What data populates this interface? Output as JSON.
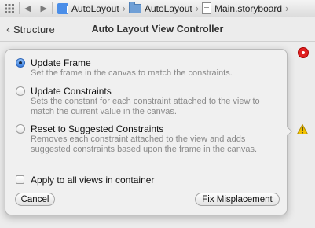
{
  "jumpbar": {
    "icons": [
      "grid-icon",
      "back-arrow-icon",
      "forward-arrow-icon"
    ],
    "path": [
      {
        "icon": "project-icon",
        "label": "AutoLayout"
      },
      {
        "icon": "folder-icon",
        "label": "AutoLayout"
      },
      {
        "icon": "storyboard-file-icon",
        "label": "Main.storyboard"
      }
    ]
  },
  "header": {
    "back_label": "Structure",
    "title": "Auto Layout View Controller"
  },
  "popover": {
    "options": [
      {
        "label": "Update Frame",
        "description": "Set the frame in the canvas to match the constraints.",
        "selected": true
      },
      {
        "label": "Update Constraints",
        "description": "Sets the constant for each constraint attached to the view to match the current value in the canvas.",
        "selected": false
      },
      {
        "label": "Reset to Suggested Constraints",
        "description": "Removes each constraint attached to the view and adds suggested constraints based upon the frame in the canvas.",
        "selected": false
      }
    ],
    "apply_all": {
      "label": "Apply to all views in container",
      "checked": false
    },
    "cancel_label": "Cancel",
    "fix_label": "Fix Misplacement"
  },
  "indicators": {
    "error_color": "#e02020",
    "warning_color": "#f2c200"
  }
}
